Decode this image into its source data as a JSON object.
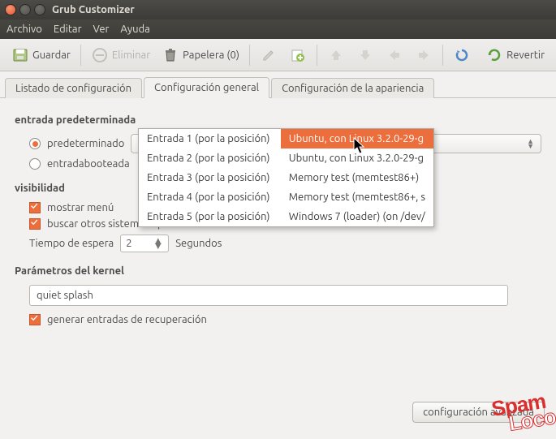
{
  "window": {
    "title": "Grub Customizer"
  },
  "menu": {
    "archivo": "Archivo",
    "editar": "Editar",
    "ver": "Ver",
    "ayuda": "Ayuda"
  },
  "toolbar": {
    "guardar": "Guardar",
    "eliminar": "Eliminar",
    "papelera": "Papelera (0)",
    "revertir": "Revertir"
  },
  "tabs": {
    "listado": "Listado de configuración",
    "general": "Configuración general",
    "apariencia": "Configuración de la apariencia"
  },
  "sections": {
    "entrada_pred": "entrada predeterminada",
    "predeterminado": "predeterminado",
    "entradabooteada": "entradabooteada",
    "visibilidad": "visibilidad",
    "mostrar_menu": "mostrar menú",
    "buscar_otros": "buscar otros sistemas operativos",
    "tiempo_espera": "Tiempo de espera",
    "segundos": "Segundos",
    "param_kernel": "Parámetros del kernel",
    "generar_recup": "generar entradas de recuperación"
  },
  "values": {
    "combo_selected": "Entrada 1 (por la posición)",
    "timeout": "2",
    "kernel_params": "quiet splash"
  },
  "dropdown": {
    "left": [
      "Entrada 1 (por la posición)",
      "Entrada 2 (por la posición)",
      "Entrada 3 (por la posición)",
      "Entrada 4 (por la posición)",
      "Entrada 5 (por la posición)"
    ],
    "right": [
      "Ubuntu, con Linux 3.2.0-29-g",
      "Ubuntu, con Linux 3.2.0-29-g",
      "Memory test (memtest86+)",
      "Memory test (memtest86+, s",
      "Windows 7 (loader) (on /dev/"
    ]
  },
  "footer": {
    "config_avanzada": "configuración avanzada"
  },
  "watermark": {
    "l1": "Spam",
    "l2": "Loco"
  }
}
